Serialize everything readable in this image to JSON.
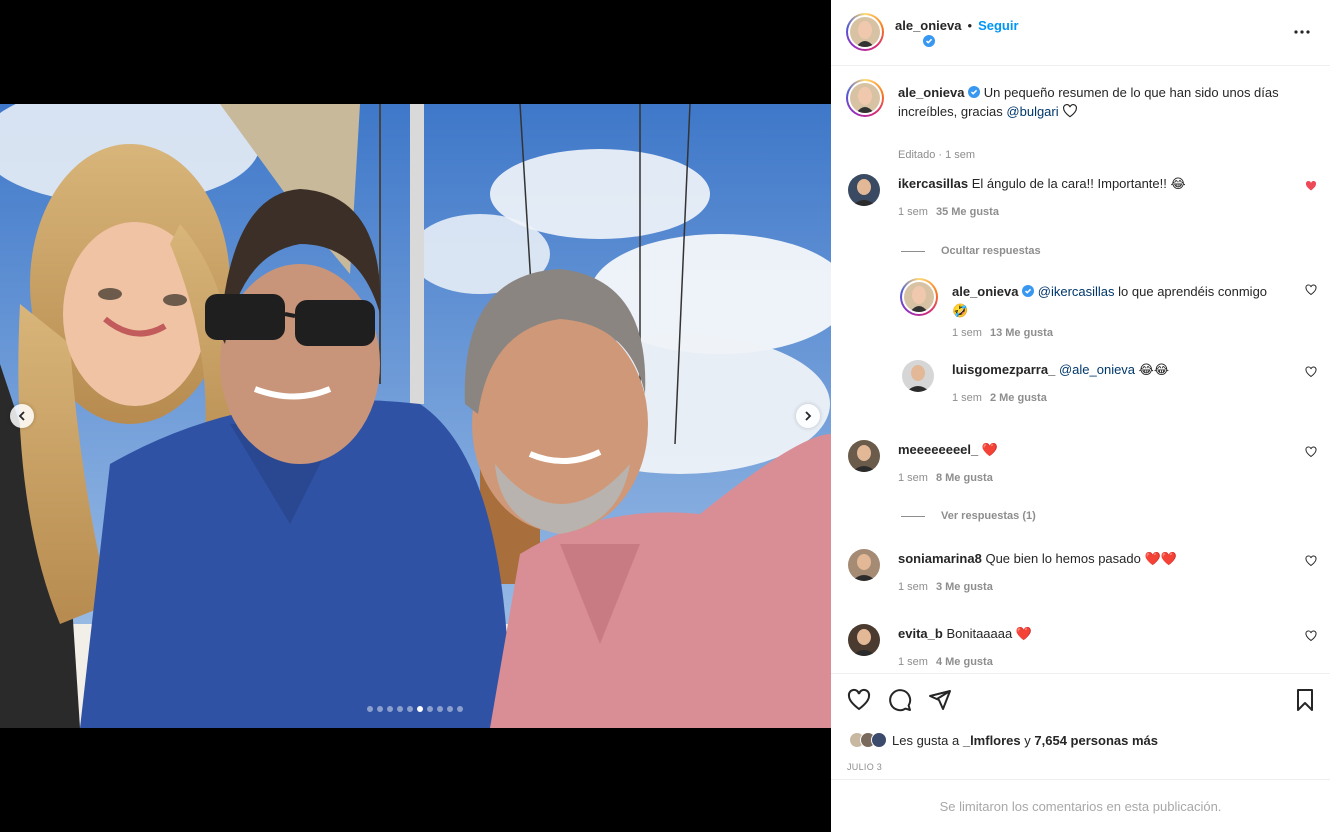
{
  "post": {
    "author": "ale_onieva",
    "follow_label": "Seguir",
    "separator": "•",
    "caption_text": "Un pequeño resumen de lo que han sido unos días increíbles, gracias",
    "caption_mention": "@bulgari",
    "caption_meta": "Editado · 1 sem",
    "carousel_total": 10,
    "carousel_active": 6
  },
  "comments": [
    {
      "user": "ikercasillas",
      "text": "El ángulo de la cara!! Importante!!",
      "emoji": "😂",
      "time": "1 sem",
      "likes": "35 Me gusta",
      "liked": true
    },
    {
      "toggle": "Ocultar respuestas"
    },
    {
      "user": "ale_onieva",
      "mention": "@ikercasillas",
      "text": "lo que aprendéis conmigo",
      "emoji": "🤣",
      "time": "1 sem",
      "likes": "13 Me gusta"
    },
    {
      "user": "luisgomezparra_",
      "mention": "@ale_onieva",
      "emoji": "😂😂",
      "time": "1 sem",
      "likes": "2 Me gusta"
    },
    {
      "user": "meeeeeeeel_",
      "emoji": "❤️",
      "time": "1 sem",
      "likes": "8 Me gusta"
    },
    {
      "toggle": "Ver respuestas (1)"
    },
    {
      "user": "soniamarina8",
      "text": "Que bien lo hemos pasado",
      "emoji": "❤️❤️",
      "time": "1 sem",
      "likes": "3 Me gusta"
    },
    {
      "user": "evita_b",
      "text": "Bonitaaaaa",
      "emoji": "❤️",
      "time": "1 sem",
      "likes": "4 Me gusta"
    }
  ],
  "likes_summary": {
    "prefix": "Les gusta a",
    "user": "_lmflores",
    "middle": "y",
    "count": "7,654 personas más"
  },
  "date": "JULIO 3",
  "limited_notice": "Se limitaron los comentarios en esta publicación.",
  "colors": {
    "accent": "#0095f6",
    "liked_heart": "#ed4956",
    "verified": "#3897f0"
  },
  "icons": [
    "chevron-left-icon",
    "chevron-right-icon",
    "more-icon",
    "verified-icon",
    "heart-icon",
    "comment-icon",
    "share-icon",
    "bookmark-icon"
  ]
}
